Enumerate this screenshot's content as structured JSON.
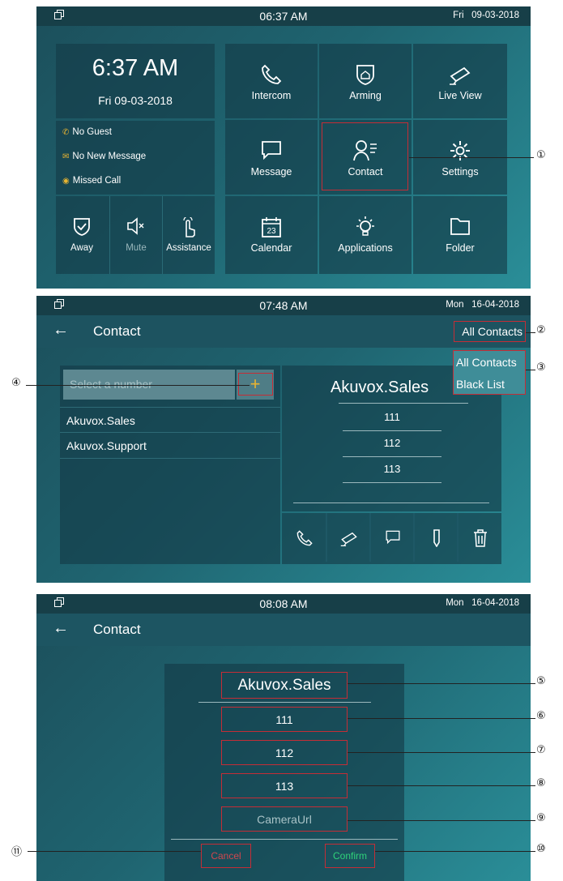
{
  "screen_home": {
    "status": {
      "time": "06:37 AM",
      "date": "Fri   09-03-2018"
    },
    "clock": {
      "time": "6:37 AM",
      "date": "Fri 09-03-2018"
    },
    "notifications": [
      "No Guest",
      "No New Message",
      "Missed Call"
    ],
    "quick_buttons": [
      {
        "label": "Away",
        "icon": "shield-check-icon"
      },
      {
        "label": "Mute",
        "icon": "speaker-mute-icon"
      },
      {
        "label": "Assistance",
        "icon": "hand-pointer-icon"
      }
    ],
    "tiles": [
      {
        "label": "Intercom",
        "icon": "phone-icon"
      },
      {
        "label": "Arming",
        "icon": "home-shield-icon"
      },
      {
        "label": "Live View",
        "icon": "camera-icon"
      },
      {
        "label": "Message",
        "icon": "message-icon"
      },
      {
        "label": "Contact",
        "icon": "contact-icon"
      },
      {
        "label": "Settings",
        "icon": "gear-icon"
      },
      {
        "label": "Calendar",
        "icon": "calendar-icon"
      },
      {
        "label": "Applications",
        "icon": "bulb-icon"
      },
      {
        "label": "Folder",
        "icon": "folder-icon"
      }
    ],
    "calendar_day": "23"
  },
  "screen_contact": {
    "status": {
      "time": "07:48 AM",
      "date": "Mon   16-04-2018"
    },
    "title": "Contact",
    "back": "←",
    "filter_selected": "All Contacts",
    "dropdown_options": [
      "All Contacts",
      "Black List"
    ],
    "search_placeholder": "Select a number",
    "add_label": "+",
    "contacts": [
      "Akuvox.Sales",
      "Akuvox.Support"
    ],
    "detail": {
      "name": "Akuvox.Sales",
      "numbers": [
        "111",
        "112",
        "113"
      ]
    }
  },
  "screen_edit": {
    "status": {
      "time": "08:08 AM",
      "date": "Mon   16-04-2018"
    },
    "title": "Contact",
    "back": "←",
    "name": "Akuvox.Sales",
    "numbers": [
      "111",
      "112",
      "113"
    ],
    "camera_placeholder": "CameraUrl",
    "cancel_label": "Cancel",
    "confirm_label": "Confirm"
  },
  "callouts": [
    "①",
    "②",
    "③",
    "④",
    "⑤",
    "⑥",
    "⑦",
    "⑧",
    "⑨",
    "⑩",
    "⑪"
  ],
  "colors": {
    "highlight": "#c52d36",
    "cancel": "#d1464e",
    "confirm": "#2fd27a",
    "notif_icon": "#e8b431"
  }
}
